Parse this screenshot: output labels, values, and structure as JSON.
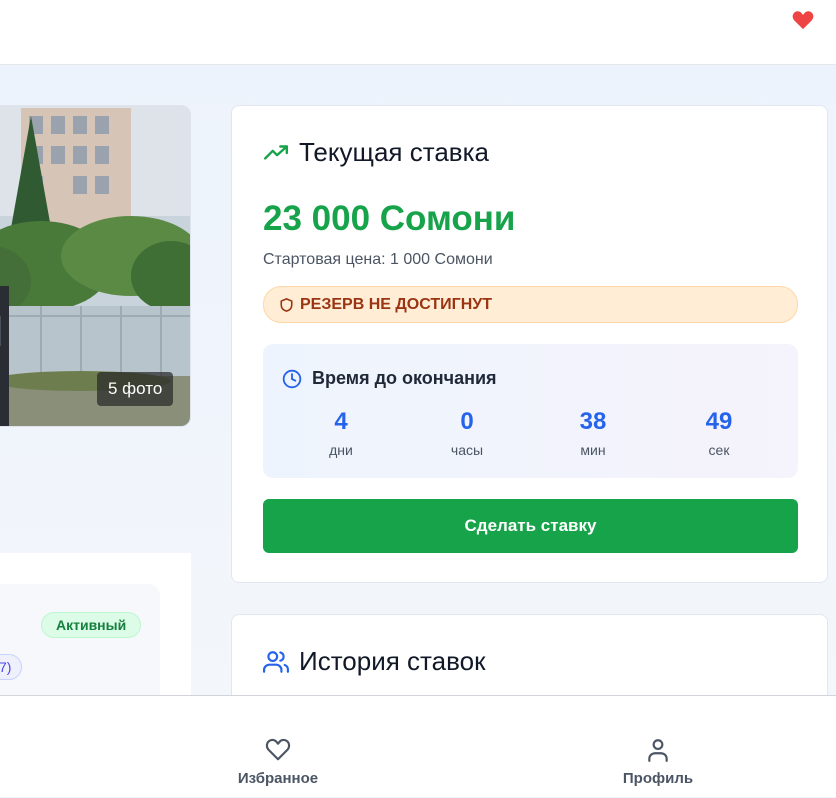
{
  "left": {
    "photo_count": "5 фото",
    "status_badge": "Активный",
    "pill_text": "7)"
  },
  "bid_card": {
    "title": "Текущая ставка",
    "current_price": "23 000 Сомони",
    "start_price": "Стартовая цена: 1 000 Сомони",
    "reserve": "РЕЗЕРВ НЕ ДОСТИГНУТ",
    "timer": {
      "title": "Время до окончания",
      "units": [
        {
          "value": "4",
          "label": "дни"
        },
        {
          "value": "0",
          "label": "часы"
        },
        {
          "value": "38",
          "label": "мин"
        },
        {
          "value": "49",
          "label": "сек"
        }
      ]
    },
    "bid_button": "Сделать ставку"
  },
  "history_card": {
    "title": "История ставок"
  },
  "bottom_nav": {
    "favorites": "Избранное",
    "profile": "Профиль"
  },
  "colors": {
    "accent_green": "#16a34a",
    "timer_blue": "#2563eb",
    "reserve_text": "#9a3412",
    "heart_red": "#ef4444"
  },
  "icons": {
    "top_right": "heart-icon",
    "bid_title": "trending-up-icon",
    "reserve": "shield-icon",
    "timer": "clock-icon",
    "history": "users-icon",
    "nav_favorites": "heart-outline-icon",
    "nav_profile": "user-icon"
  }
}
